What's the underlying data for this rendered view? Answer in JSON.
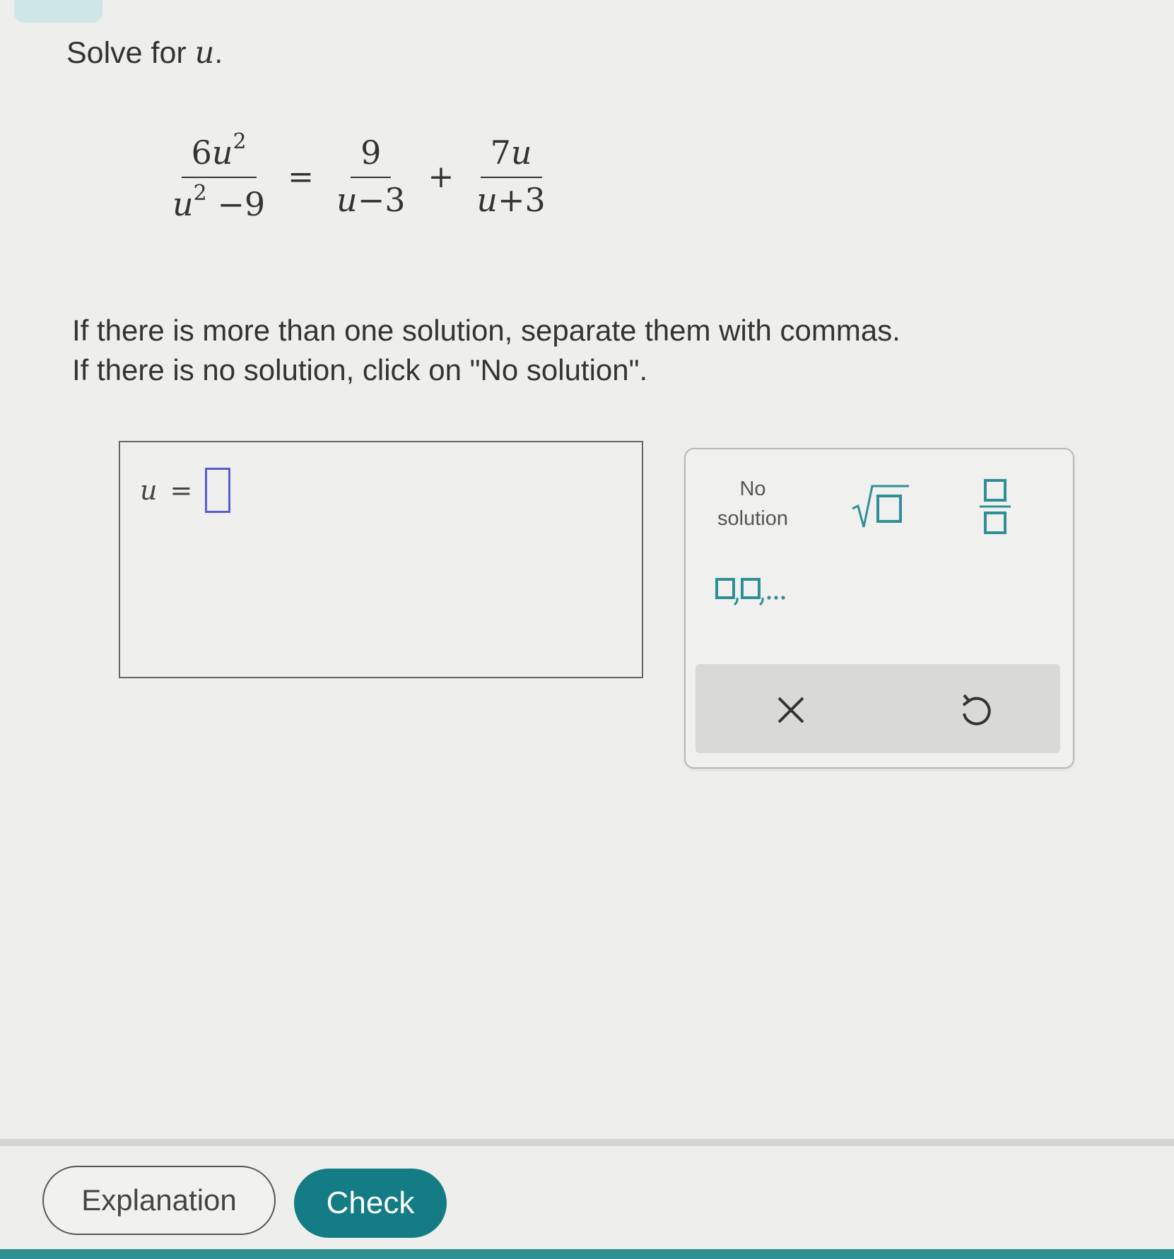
{
  "prompt": {
    "text": "Solve for",
    "variable": "u",
    "end": "."
  },
  "equation": {
    "lhs": {
      "num_coef": "6",
      "num_var": "u",
      "num_exp": "2",
      "den_var": "u",
      "den_exp": "2",
      "den_rest": "−9"
    },
    "eq": "=",
    "term1": {
      "num": "9",
      "den_var": "u",
      "den_rest": "−3"
    },
    "plus": "+",
    "term2": {
      "num_coef": "7",
      "num_var": "u",
      "den_var": "u",
      "den_rest": "+3"
    }
  },
  "instructions": {
    "line1": "If there is more than one solution, separate them with commas.",
    "line2": "If there is no solution, click on \"No solution\"."
  },
  "answer": {
    "variable": "u",
    "eq": "=",
    "value": ""
  },
  "keypad": {
    "no_solution_line1": "No",
    "no_solution_line2": "solution",
    "sqrt_icon": "sqrt-icon",
    "fraction_icon": "fraction-icon",
    "list_icon": "list-icon",
    "clear_icon": "clear-icon",
    "undo_icon": "undo-icon",
    "accent_color": "#2f8f98"
  },
  "buttons": {
    "explanation": "Explanation",
    "check": "Check"
  },
  "colors": {
    "check_bg": "#137c84",
    "input_border": "#5b5bd6"
  }
}
